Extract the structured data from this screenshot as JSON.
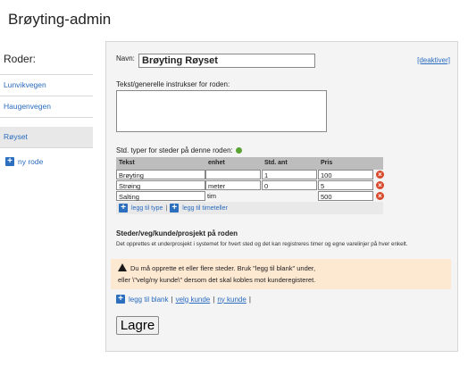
{
  "app": {
    "title": "Brøyting-admin"
  },
  "sidebar": {
    "heading": "Roder:",
    "items": [
      {
        "label": "Lunvikvegen"
      },
      {
        "label": "Haugenvegen"
      }
    ],
    "active_item": {
      "label": "Røyset"
    },
    "add_label": "ny rode"
  },
  "form": {
    "name_label": "Navn:",
    "name_value": "Brøyting Røyset",
    "deactivate_label": "[deaktiver]",
    "instructions_label": "Tekst/generelle instrukser for roden:",
    "instructions_value": "",
    "types_label": "Std. typer for steder på denne roden:",
    "table": {
      "headers": {
        "tekst": "Tekst",
        "enhet": "enhet",
        "std_ant": "Std. ant",
        "pris": "Pris"
      },
      "rows": [
        {
          "tekst": "Brøyting",
          "enhet": "",
          "std_ant": "1",
          "pris": "100"
        },
        {
          "tekst": "Strøing",
          "enhet": "meter",
          "std_ant": "0",
          "pris": "5"
        },
        {
          "tekst": "Salting",
          "enhet": "tim",
          "std_ant": "",
          "pris": "500"
        }
      ],
      "add_type_label": "legg til type",
      "separator": "|",
      "add_timeteller_label": "legg til timeteller"
    },
    "section_title": "Steder/veg/kunde/prosjekt på roden",
    "section_desc": "Det opprettes et underprosjekt i systemet for hvert sted og det kan registreres timer og egne varelinjer på hver enkelt.",
    "warning": {
      "line1": "Du må opprette et eller flere steder. Bruk \"legg til blank\" under,",
      "line2": "eller \\\"velg/ny kunde\\\" dersom det skal kobles mot kunderegisteret."
    },
    "add_links": {
      "blank": "legg til blank",
      "choose_customer": "velg kunde",
      "new_customer": "ny kunde",
      "separator": "|"
    },
    "save_label": "Lagre"
  },
  "colors": {
    "link": "#2a6bbf",
    "accent": "#2c6fbf",
    "warning_bg": "#fde8d2",
    "remove": "#d8492c",
    "help": "#5aa333"
  }
}
